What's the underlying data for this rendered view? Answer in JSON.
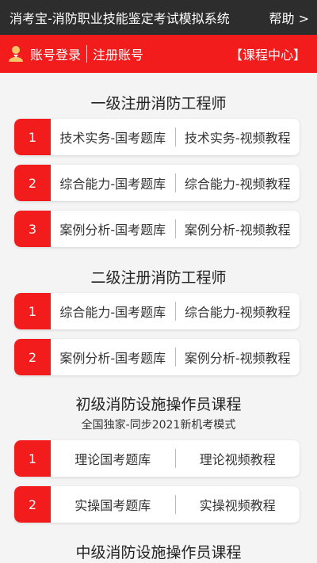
{
  "header": {
    "title": "消考宝-消防职业技能鉴定考试模拟系统",
    "help": "帮助 >"
  },
  "account": {
    "login": "账号登录",
    "register": "注册账号",
    "course_center": "【课程中心】"
  },
  "colors": {
    "accent": "#f21c1c",
    "topbar": "#2d2d2d",
    "background": "#f4f4f4"
  },
  "sections": [
    {
      "title": "一级注册消防工程师",
      "rows": [
        {
          "num": "1",
          "left": "技术实务-国考题库",
          "right": "技术实务-视频教程"
        },
        {
          "num": "2",
          "left": "综合能力-国考题库",
          "right": "综合能力-视频教程"
        },
        {
          "num": "3",
          "left": "案例分析-国考题库",
          "right": "案例分析-视频教程"
        }
      ]
    },
    {
      "title": "二级注册消防工程师",
      "rows": [
        {
          "num": "1",
          "left": "综合能力-国考题库",
          "right": "综合能力-视频教程"
        },
        {
          "num": "2",
          "left": "案例分析-国考题库",
          "right": "案例分析-视频教程"
        }
      ]
    },
    {
      "title": "初级消防设施操作员课程",
      "subtitle": "全国独家-同步2021新机考模式",
      "rows": [
        {
          "num": "1",
          "left": "理论国考题库",
          "right": "理论视频教程"
        },
        {
          "num": "2",
          "left": "实操国考题库",
          "right": "实操视频教程"
        }
      ]
    },
    {
      "title": "中级消防设施操作员课程"
    }
  ]
}
